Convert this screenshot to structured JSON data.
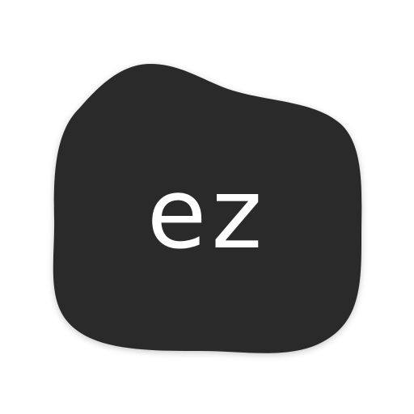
{
  "app": {
    "logo_text": "ez"
  },
  "colors": {
    "background": "#ffffff",
    "blob_fill": "#2c2c2c",
    "text": "#ffffff"
  },
  "icons": {
    "logo": "ez-blob-logo-icon"
  }
}
